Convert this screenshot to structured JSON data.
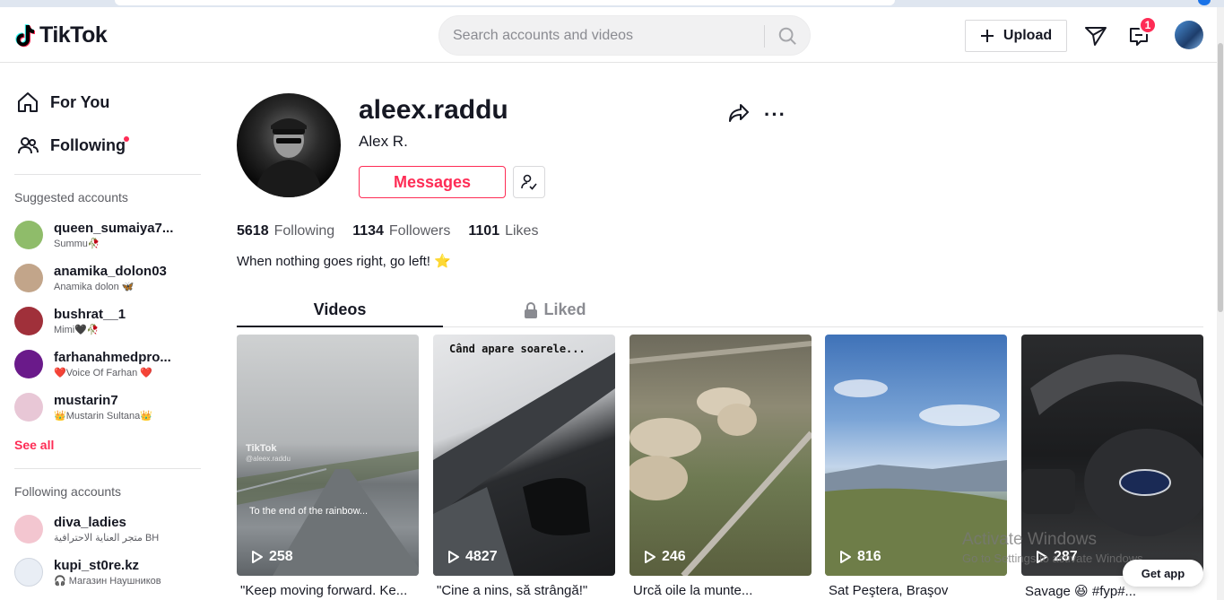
{
  "header": {
    "logo_text": "TikTok",
    "search_placeholder": "Search accounts and videos",
    "upload_label": "Upload",
    "inbox_badge": "1"
  },
  "sidebar": {
    "nav": [
      {
        "label": "For You",
        "icon": "home-icon"
      },
      {
        "label": "Following",
        "icon": "users-icon"
      }
    ],
    "suggested_title": "Suggested accounts",
    "suggested": [
      {
        "username": "queen_sumaiya7...",
        "nickname": "Summu🥀",
        "color": "#8fbc6a"
      },
      {
        "username": "anamika_dolon03",
        "nickname": "Anamika dolon 🦋",
        "color": "#c2a58a"
      },
      {
        "username": "bushrat__1",
        "nickname": "Mimi🖤🥀",
        "color": "#a0303a"
      },
      {
        "username": "farhanahmedpro...",
        "nickname": "❤️Voice Of Farhan ❤️",
        "color": "#6a1a8a"
      },
      {
        "username": "mustarin7",
        "nickname": "👑Mustarin Sultana👑",
        "color": "#e8c7d6"
      }
    ],
    "see_all": "See all",
    "following_title": "Following accounts",
    "following": [
      {
        "username": "diva_ladies",
        "nickname": "متجر العناية الاحترافية BH",
        "color": "#f3c6d0"
      },
      {
        "username": "kupi_st0re.kz",
        "nickname": "🎧 Магазин Наушников",
        "color": "#e9eef5"
      }
    ]
  },
  "profile": {
    "username": "aleex.raddu",
    "display_name": "Alex R.",
    "messages_label": "Messages",
    "following_count": "5618",
    "following_label": "Following",
    "followers_count": "1134",
    "followers_label": "Followers",
    "likes_count": "1101",
    "likes_label": "Likes",
    "bio": "When nothing goes right, go left! ⭐"
  },
  "tabs": {
    "videos": "Videos",
    "liked": "Liked"
  },
  "videos": [
    {
      "views": "258",
      "caption": "\"Keep moving forward. Ke...",
      "overlay": "To the end of the rainbow...",
      "watermark": "TikTok",
      "handle": "@aleex.raddu"
    },
    {
      "views": "4827",
      "caption": "\"Cine a nins, să strângă!\"",
      "overlay": "Când apare soarele..."
    },
    {
      "views": "246",
      "caption": "Urcă oile la munte..."
    },
    {
      "views": "816",
      "caption": "Sat Peştera, Braşov"
    },
    {
      "views": "287",
      "caption": "Savage 😆 #fyp#..."
    }
  ],
  "watermark": {
    "line1": "Activate Windows",
    "line2": "Go to Settings to activate Windows."
  },
  "get_app": "Get app"
}
